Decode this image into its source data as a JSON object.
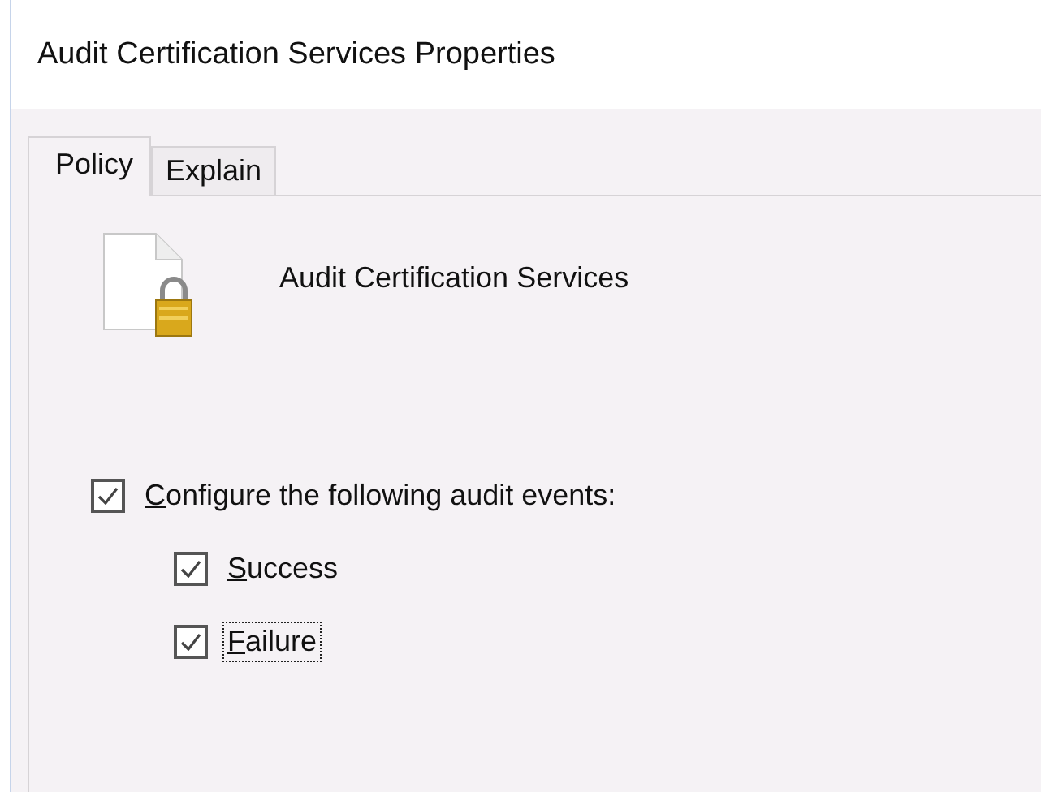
{
  "window": {
    "title": "Audit Certification Services Properties"
  },
  "tabs": [
    {
      "label": "Policy",
      "selected": true
    },
    {
      "label": "Explain",
      "selected": false
    }
  ],
  "policy": {
    "name": "Audit Certification Services"
  },
  "options": [
    {
      "label": "Configure the following audit events:",
      "checked": true,
      "focused": false,
      "kind": "main",
      "mnemonic_underlined": true
    },
    {
      "label": "Success",
      "checked": true,
      "focused": false,
      "kind": "sub",
      "mnemonic_underlined": true
    },
    {
      "label": "Failure",
      "checked": true,
      "focused": true,
      "kind": "sub",
      "mnemonic_underlined": true
    }
  ]
}
